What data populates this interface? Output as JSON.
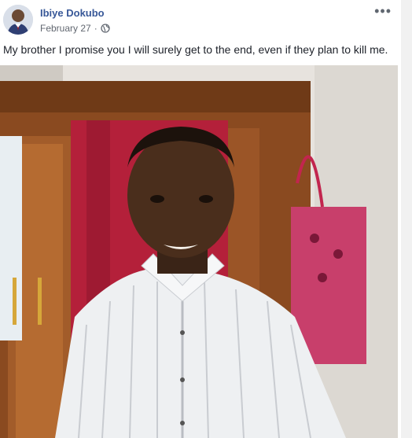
{
  "post": {
    "author": "Ibiye Dokubo",
    "date": "February 27",
    "separator": "·",
    "privacy_icon": "globe-icon",
    "more_icon": "more-options-icon",
    "more_label": "•••",
    "body": "My brother I promise you I will surely get to the end, even if they plan to kill me."
  },
  "colors": {
    "author": "#385898",
    "meta": "#616770",
    "text": "#1d2129"
  }
}
